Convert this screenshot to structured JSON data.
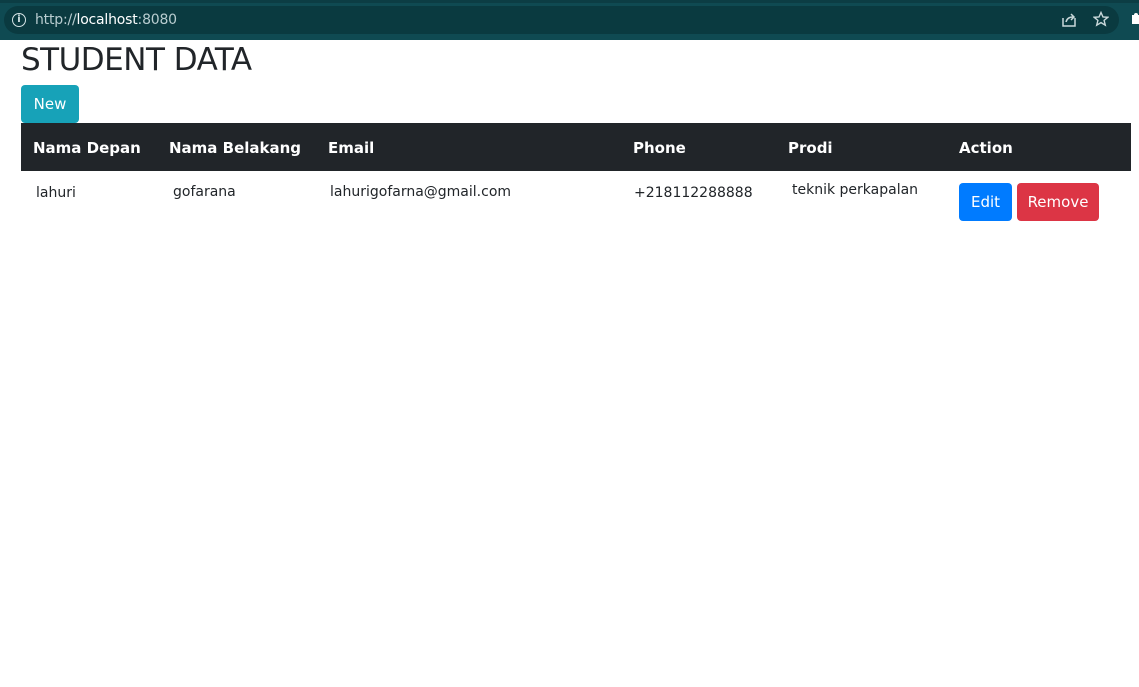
{
  "browser": {
    "url_scheme": "http://",
    "url_host": "localhost",
    "url_port": ":8080"
  },
  "page": {
    "title": "STUDENT DATA",
    "new_button": "New"
  },
  "table": {
    "columns": [
      "Nama Depan",
      "Nama Belakang",
      "Email",
      "Phone",
      "Prodi",
      "Action"
    ],
    "rows": [
      {
        "nama_depan": "lahuri",
        "nama_belakang": "gofarana",
        "email": "lahurigofarna@gmail.com",
        "phone": "+218112288888",
        "prodi": "teknik perkapalan",
        "edit_label": "Edit",
        "remove_label": "Remove"
      }
    ]
  },
  "colors": {
    "new_button": "#17a2b8",
    "edit_button": "#007bff",
    "remove_button": "#dc3545",
    "table_header": "#212529",
    "browser_bar": "#0f4a52"
  }
}
